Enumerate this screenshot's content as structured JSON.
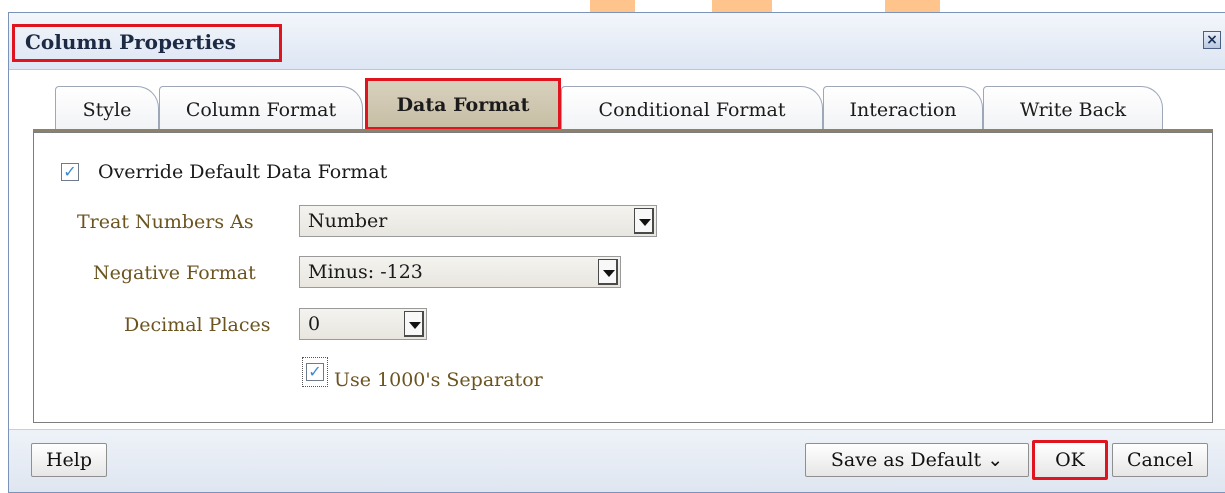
{
  "dialog": {
    "title": "Column Properties",
    "close_glyph": "×"
  },
  "tabs": [
    {
      "label": "Style",
      "active": false
    },
    {
      "label": "Column Format",
      "active": false
    },
    {
      "label": "Data Format",
      "active": true
    },
    {
      "label": "Conditional Format",
      "active": false
    },
    {
      "label": "Interaction",
      "active": false
    },
    {
      "label": "Write Back",
      "active": false
    }
  ],
  "data_format": {
    "override_label": "Override Default Data Format",
    "override_checked": true,
    "treat_numbers_label": "Treat Numbers As",
    "treat_numbers_value": "Number",
    "negative_format_label": "Negative Format",
    "negative_format_value": "Minus: -123",
    "decimal_places_label": "Decimal Places",
    "decimal_places_value": "0",
    "separator_label": "Use 1000's Separator",
    "separator_checked": true,
    "check_glyph": "✓"
  },
  "footer": {
    "help_label": "Help",
    "save_default_label": "Save as Default",
    "save_default_arrow": "⌄",
    "ok_label": "OK",
    "cancel_label": "Cancel"
  },
  "colors": {
    "highlight": "#e0141e",
    "label_text": "#6b5420",
    "active_tab": "#c7bea5"
  }
}
